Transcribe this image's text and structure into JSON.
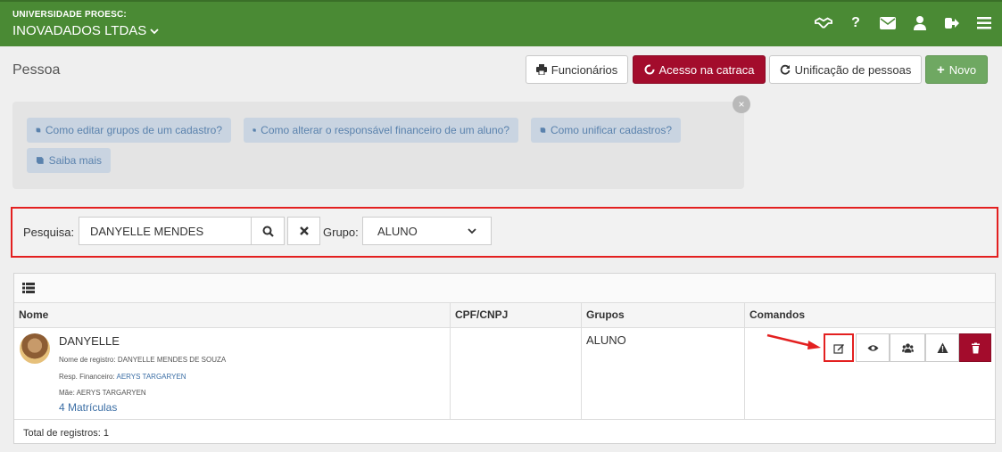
{
  "header": {
    "org": "UNIVERSIDADE PROESC:",
    "company": "INOVADADOS LTDAS",
    "icons": [
      "handshake-icon",
      "question-icon",
      "envelope-icon",
      "user-icon",
      "sign-out-icon",
      "menu-icon"
    ],
    "color": "#4a8a34"
  },
  "page": {
    "title": "Pessoa"
  },
  "toolbar": {
    "funcionarios": "Funcionários",
    "catraca": "Acesso na catraca",
    "unificacao": "Unificação de pessoas",
    "novo": "Novo"
  },
  "help": {
    "links": [
      "Como editar grupos de um cadastro?",
      "Como alterar o responsável financeiro de um aluno?",
      "Como unificar cadastros?",
      "Saiba mais"
    ],
    "close": "×"
  },
  "search": {
    "label": "Pesquisa:",
    "value": "DANYELLE MENDES",
    "group_label": "Grupo:",
    "group_value": "ALUNO"
  },
  "table": {
    "columns": [
      "Nome",
      "CPF/CNPJ",
      "Grupos",
      "Comandos"
    ],
    "rows": [
      {
        "name": "DANYELLE",
        "registro_label": "Nome de registro:",
        "registro": "DANYELLE MENDES DE SOUZA",
        "resp_label": "Resp. Financeiro:",
        "resp": "AERYS TARGARYEN",
        "mae_label": "Mãe:",
        "mae": "AERYS TARGARYEN",
        "matriculas": "4 Matrículas",
        "cpf": "",
        "grupo": "ALUNO"
      }
    ],
    "total": "Total de registros: 1"
  },
  "colors": {
    "primary_red": "#a30c2c",
    "success_green": "#6fa862",
    "highlight": "#e32020",
    "link": "#3b6ea5"
  }
}
